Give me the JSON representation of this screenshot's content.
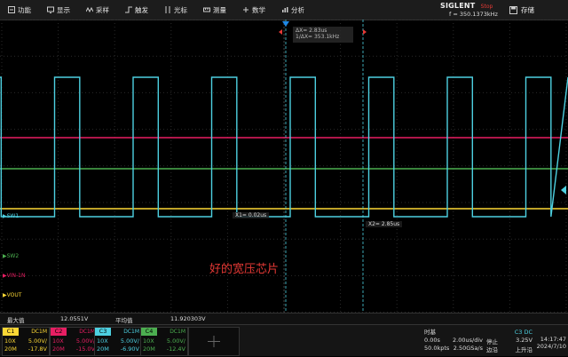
{
  "menu": [
    {
      "label": "功能",
      "icon": "function-icon"
    },
    {
      "label": "显示",
      "icon": "display-icon"
    },
    {
      "label": "采样",
      "icon": "acquire-icon"
    },
    {
      "label": "触发",
      "icon": "trigger-icon"
    },
    {
      "label": "光标",
      "icon": "cursor-icon"
    },
    {
      "label": "测量",
      "icon": "measure-icon"
    },
    {
      "label": "数学",
      "icon": "math-icon"
    },
    {
      "label": "分析",
      "icon": "analysis-icon"
    }
  ],
  "brand": {
    "logo": "SIGLENT",
    "status": "Stop",
    "frequency": "f = 350.1373kHz"
  },
  "save_label": "存储",
  "cursors": {
    "delta": "ΔX= 2.83us",
    "inverse": "1/ΔX= 353.1kHz",
    "x1": "X1= 0.02us",
    "x2": "X2= 2.85us"
  },
  "channel_markers": [
    {
      "label": "SW1",
      "color": "#4dd0e1"
    },
    {
      "label": "SW2",
      "color": "#4caf50"
    },
    {
      "label": "VIN-1N",
      "color": "#e91e63"
    },
    {
      "label": "VOUT",
      "color": "#fdd835"
    }
  ],
  "annotation": "好的宽压芯片",
  "measure": {
    "max_label": "最大值",
    "max_value": "12.0551V",
    "mean_label": "平均值",
    "mean_value": "11.920303V"
  },
  "channels": [
    {
      "tag": "C1",
      "coupling": "DC1M",
      "probe": "10X",
      "scale": "5.00V/",
      "bw": "20M",
      "offset": "-17.8V",
      "color": "#fdd835"
    },
    {
      "tag": "C2",
      "coupling": "DC1M",
      "probe": "10X",
      "scale": "5.00V/",
      "bw": "20M",
      "offset": "-15.0V",
      "color": "#e91e63"
    },
    {
      "tag": "C3",
      "coupling": "DC1M",
      "probe": "10X",
      "scale": "5.00V/",
      "bw": "20M",
      "offset": "-6.90V",
      "color": "#4dd0e1"
    },
    {
      "tag": "C4",
      "coupling": "DC1M",
      "probe": "10X",
      "scale": "5.00V/",
      "bw": "20M",
      "offset": "-12.4V",
      "color": "#4caf50"
    }
  ],
  "timebase": {
    "label": "时基",
    "delay": "0.00s",
    "scale": "2.00us/div",
    "points": "50.0kpts",
    "rate": "2.50GSa/s"
  },
  "trigger": {
    "source": "C3 DC",
    "level": "3.25V",
    "mode": "停止",
    "slope_type": "边沿",
    "slope": "上升沿"
  },
  "clock": {
    "time": "14:17:47",
    "date": "2024/7/10"
  }
}
